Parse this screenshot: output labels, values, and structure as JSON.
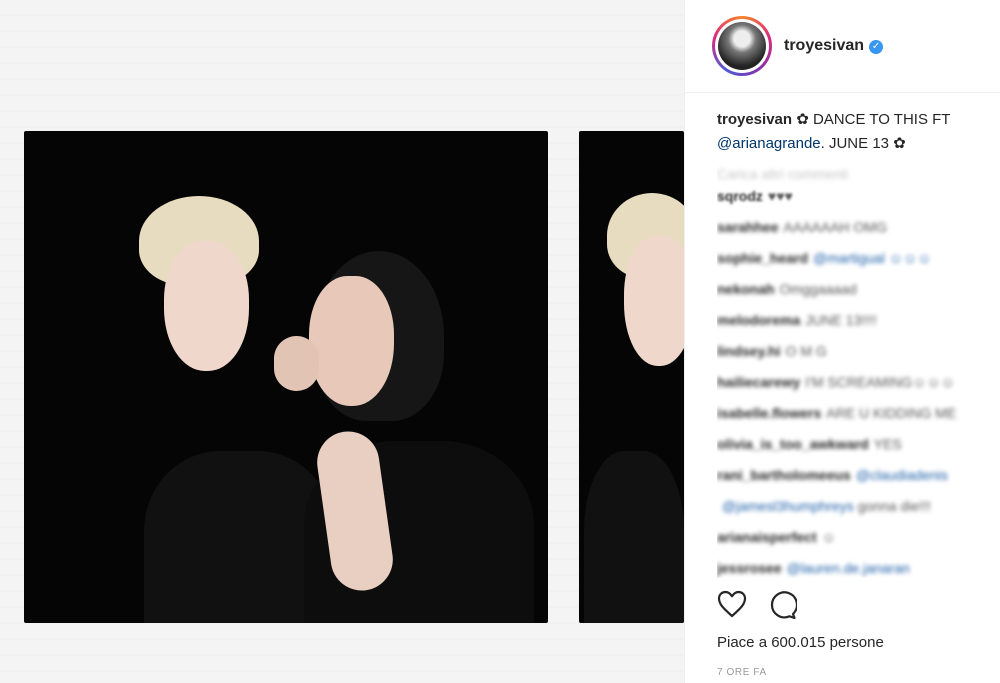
{
  "post": {
    "username": "troyesivan",
    "verified_icon": "verified-badge-icon",
    "caption": {
      "user": "troyesivan",
      "text_1": " ✿ DANCE TO THIS FT ",
      "mention": "@arianagrande",
      "text_2": ". JUNE 13 ✿"
    },
    "load_more": "Carica altri commenti",
    "comments": [
      {
        "user": "sqrodz",
        "text": "♥♥♥",
        "mention": ""
      },
      {
        "user": "sarahhee",
        "text": "AAAAAAH OMG",
        "mention": ""
      },
      {
        "user": "sophie_heard",
        "text": "",
        "mention": "@martigual ☺☺☺"
      },
      {
        "user": "nekonah",
        "text": "Omggaaaad",
        "mention": ""
      },
      {
        "user": "melodorema",
        "text": "JUNE 13!!!!",
        "mention": ""
      },
      {
        "user": "lindsey.hi",
        "text": "O M G",
        "mention": ""
      },
      {
        "user": "hailiecarewy",
        "text": "I'M SCREAMING☺☺☺",
        "mention": ""
      },
      {
        "user": "isabelle.flowers",
        "text": "ARE U KIDDING ME",
        "mention": ""
      },
      {
        "user": "olivia_is_too_awkward",
        "text": "YES",
        "mention": ""
      },
      {
        "user": "rani_bartholomeeus",
        "text": "",
        "mention": "@claudiadenis"
      },
      {
        "user": "",
        "text": " gonna die!!!",
        "mention": "@jamesl3humphreys"
      },
      {
        "user": "arianaisperfect",
        "text": "☺",
        "mention": ""
      },
      {
        "user": "jessrosee",
        "text": "",
        "mention": "@lauren.de.janaran"
      }
    ],
    "likes": "Piace a 600.015 persone",
    "time": "7 ORE FA"
  }
}
